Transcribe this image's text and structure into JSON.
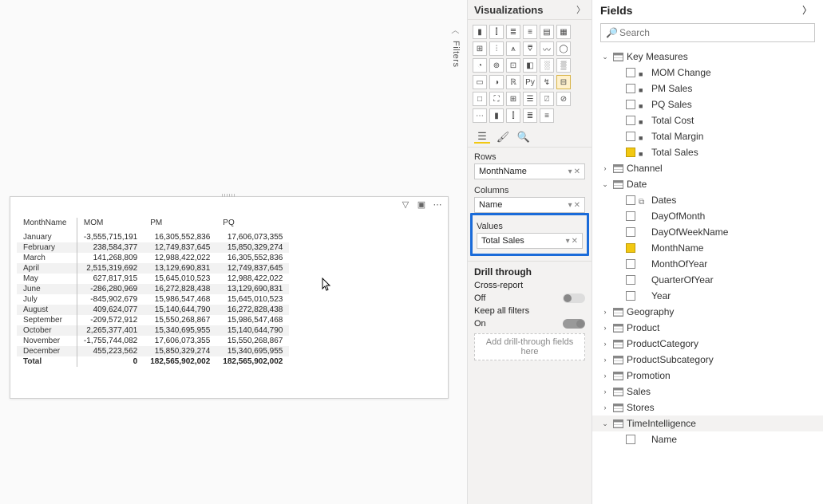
{
  "pane_viz_title": "Visualizations",
  "pane_fields_title": "Fields",
  "filters_tab": "Filters",
  "search_placeholder": "Search",
  "wells": {
    "rows_label": "Rows",
    "rows_item": "MonthName",
    "cols_label": "Columns",
    "cols_item": "Name",
    "values_label": "Values",
    "values_item": "Total Sales"
  },
  "drill": {
    "header": "Drill through",
    "cross_label": "Cross-report",
    "cross_value": "Off",
    "keep_label": "Keep all filters",
    "keep_value": "On",
    "dropzone": "Add drill-through fields here"
  },
  "matrix": {
    "headers": [
      "MonthName",
      "MOM",
      "PM",
      "PQ"
    ],
    "rows": [
      {
        "m": "January",
        "mom": "-3,555,715,191",
        "pm": "16,305,552,836",
        "pq": "17,606,073,355"
      },
      {
        "m": "February",
        "mom": "238,584,377",
        "pm": "12,749,837,645",
        "pq": "15,850,329,274"
      },
      {
        "m": "March",
        "mom": "141,268,809",
        "pm": "12,988,422,022",
        "pq": "16,305,552,836"
      },
      {
        "m": "April",
        "mom": "2,515,319,692",
        "pm": "13,129,690,831",
        "pq": "12,749,837,645"
      },
      {
        "m": "May",
        "mom": "627,817,915",
        "pm": "15,645,010,523",
        "pq": "12,988,422,022"
      },
      {
        "m": "June",
        "mom": "-286,280,969",
        "pm": "16,272,828,438",
        "pq": "13,129,690,831"
      },
      {
        "m": "July",
        "mom": "-845,902,679",
        "pm": "15,986,547,468",
        "pq": "15,645,010,523"
      },
      {
        "m": "August",
        "mom": "409,624,077",
        "pm": "15,140,644,790",
        "pq": "16,272,828,438"
      },
      {
        "m": "September",
        "mom": "-209,572,912",
        "pm": "15,550,268,867",
        "pq": "15,986,547,468"
      },
      {
        "m": "October",
        "mom": "2,265,377,401",
        "pm": "15,340,695,955",
        "pq": "15,140,644,790"
      },
      {
        "m": "November",
        "mom": "-1,755,744,082",
        "pm": "17,606,073,355",
        "pq": "15,550,268,867"
      },
      {
        "m": "December",
        "mom": "455,223,562",
        "pm": "15,850,329,274",
        "pq": "15,340,695,955"
      }
    ],
    "total": {
      "m": "Total",
      "mom": "0",
      "pm": "182,565,902,002",
      "pq": "182,565,902,002"
    }
  },
  "fields_tree": [
    {
      "type": "table",
      "name": "Key Measures",
      "expanded": true,
      "icon": "key",
      "children": [
        {
          "type": "field",
          "name": "MOM Change",
          "checked": false,
          "kind": "calc"
        },
        {
          "type": "field",
          "name": "PM Sales",
          "checked": false,
          "kind": "calc"
        },
        {
          "type": "field",
          "name": "PQ Sales",
          "checked": false,
          "kind": "calc"
        },
        {
          "type": "field",
          "name": "Total Cost",
          "checked": false,
          "kind": "calc"
        },
        {
          "type": "field",
          "name": "Total Margin",
          "checked": false,
          "kind": "calc"
        },
        {
          "type": "field",
          "name": "Total Sales",
          "checked": true,
          "kind": "calc"
        }
      ]
    },
    {
      "type": "table",
      "name": "Channel",
      "expanded": false
    },
    {
      "type": "table",
      "name": "Date",
      "expanded": true,
      "icon": "date",
      "children": [
        {
          "type": "field",
          "name": "Dates",
          "checked": false,
          "kind": "date"
        },
        {
          "type": "field",
          "name": "DayOfMonth",
          "checked": false,
          "kind": "std"
        },
        {
          "type": "field",
          "name": "DayOfWeekName",
          "checked": false,
          "kind": "std"
        },
        {
          "type": "field",
          "name": "MonthName",
          "checked": true,
          "kind": "std"
        },
        {
          "type": "field",
          "name": "MonthOfYear",
          "checked": false,
          "kind": "std"
        },
        {
          "type": "field",
          "name": "QuarterOfYear",
          "checked": false,
          "kind": "std"
        },
        {
          "type": "field",
          "name": "Year",
          "checked": false,
          "kind": "std"
        }
      ]
    },
    {
      "type": "table",
      "name": "Geography",
      "expanded": false
    },
    {
      "type": "table",
      "name": "Product",
      "expanded": false
    },
    {
      "type": "table",
      "name": "ProductCategory",
      "expanded": false
    },
    {
      "type": "table",
      "name": "ProductSubcategory",
      "expanded": false
    },
    {
      "type": "table",
      "name": "Promotion",
      "expanded": false
    },
    {
      "type": "table",
      "name": "Sales",
      "expanded": false
    },
    {
      "type": "table",
      "name": "Stores",
      "expanded": false
    },
    {
      "type": "table",
      "name": "TimeIntelligence",
      "expanded": true,
      "active": true,
      "icon": "calc",
      "children": [
        {
          "type": "field",
          "name": "Name",
          "checked": false,
          "kind": "std"
        }
      ]
    }
  ],
  "viz_grid_count": 35,
  "viz_selected_index": 23
}
